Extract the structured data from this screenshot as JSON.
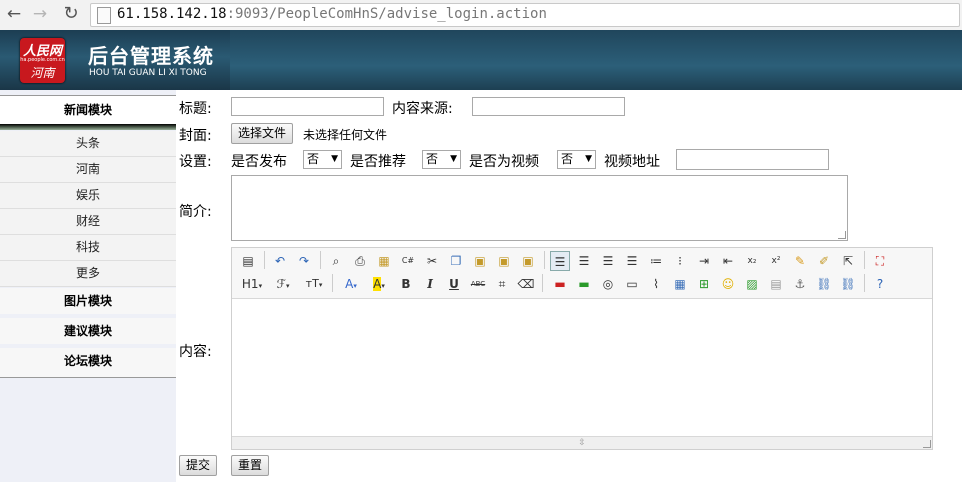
{
  "browser": {
    "url_host": "61.158.142.18",
    "url_rest": ":9093/PeopleComHnS/advise_login.action"
  },
  "header": {
    "logo_top": "人民网",
    "logo_url": "ha.people.com.cn",
    "logo_bottom": "河南",
    "title": "后台管理系统",
    "subtitle": "HOU TAI GUAN LI XI TONG"
  },
  "sidebar": {
    "news": "新闻模块",
    "news_items": [
      "头条",
      "河南",
      "娱乐",
      "财经",
      "科技",
      "更多"
    ],
    "pictures": "图片模块",
    "advice": "建议模块",
    "forum": "论坛模块"
  },
  "form": {
    "title_label": "标题:",
    "source_label": "内容来源:",
    "cover_label": "封面:",
    "choose_file": "选择文件",
    "no_file": "未选择任何文件",
    "settings_label": "设置:",
    "publish_label": "是否发布",
    "publish_value": "否",
    "recommend_label": "是否推荐",
    "recommend_value": "否",
    "video_label": "是否为视频",
    "video_value": "否",
    "video_url_label": "视频地址",
    "summary_label": "简介:",
    "content_label": "内容:",
    "submit": "提交",
    "reset": "重置"
  },
  "editor": {
    "row2_text": [
      "H1",
      "ℱ",
      "тT",
      "A",
      "A",
      "B",
      "I",
      "U",
      "ABC"
    ]
  },
  "colors": {
    "banner": "#2a5a73",
    "logo": "#c8181e"
  }
}
